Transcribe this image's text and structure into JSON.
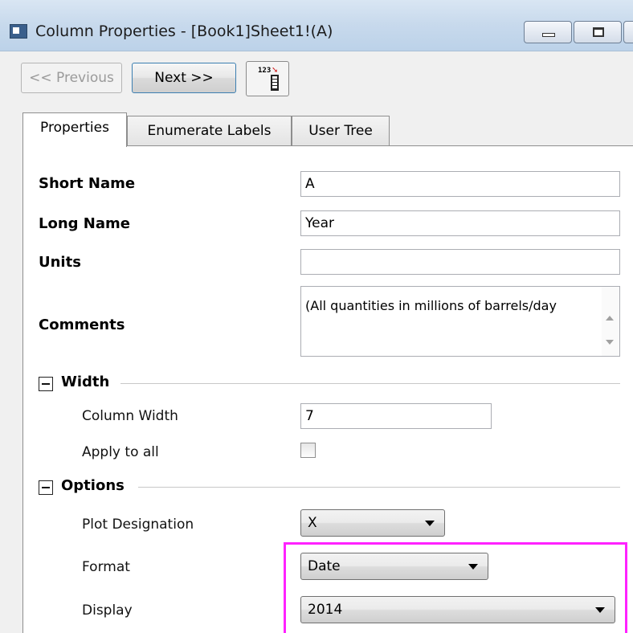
{
  "window": {
    "title": "Column Properties - [Book1]Sheet1!(A)"
  },
  "toolbar": {
    "previous_label": "<< Previous",
    "next_label": "Next >>",
    "column_icon_text": "123"
  },
  "tabs": [
    {
      "label": "Properties",
      "active": true
    },
    {
      "label": "Enumerate Labels",
      "active": false
    },
    {
      "label": "User Tree",
      "active": false
    }
  ],
  "properties": {
    "short_name_label": "Short Name",
    "short_name_value": "A",
    "long_name_label": "Long Name",
    "long_name_value": "Year",
    "units_label": "Units",
    "units_value": "",
    "comments_label": "Comments",
    "comments_value": "(All quantities in millions of barrels/day"
  },
  "width_section": {
    "title": "Width",
    "column_width_label": "Column Width",
    "column_width_value": "7",
    "apply_to_all_label": "Apply to all",
    "apply_to_all_checked": false
  },
  "options_section": {
    "title": "Options",
    "plot_designation_label": "Plot Designation",
    "plot_designation_value": "X",
    "format_label": "Format",
    "format_value": "Date",
    "display_label": "Display",
    "display_value": "2014"
  },
  "colors": {
    "highlight": "#ff22ff",
    "titlebar": "#c7d9ec"
  }
}
